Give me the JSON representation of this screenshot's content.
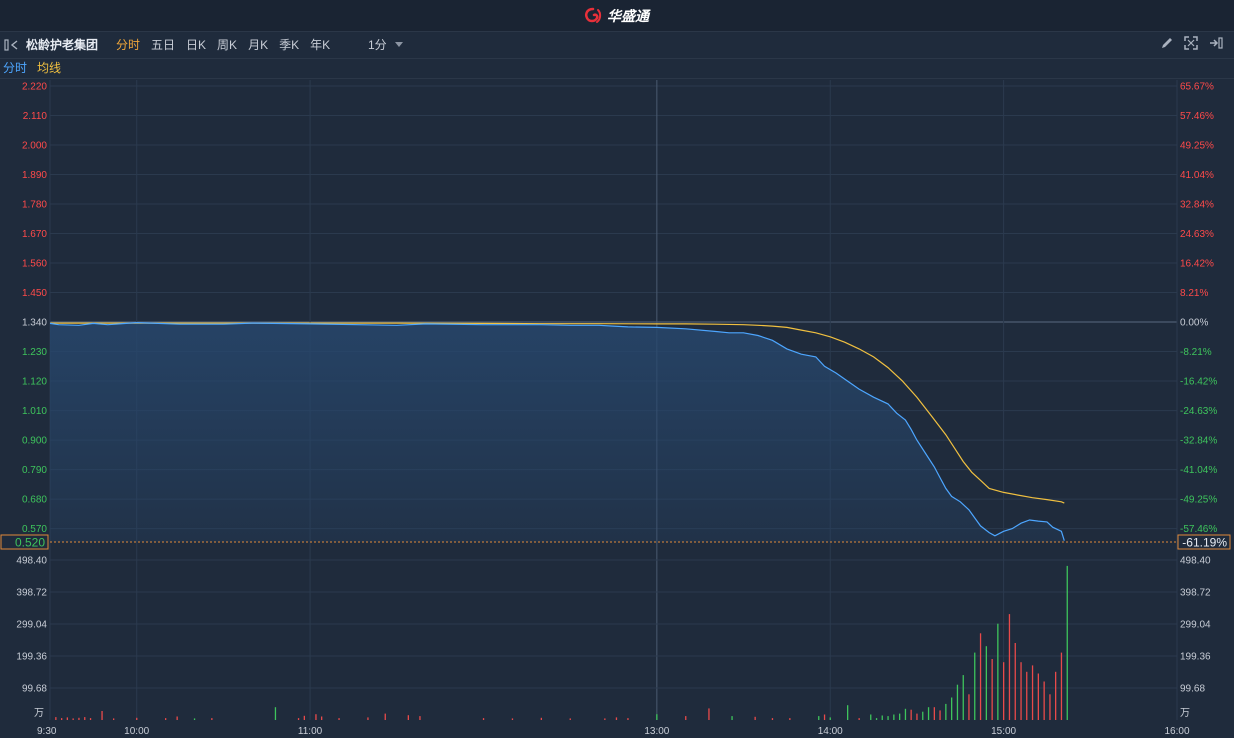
{
  "header": {
    "brand": "华盛通",
    "brand_color": "#e8303a",
    "brand_icon": "swirl-logo-icon"
  },
  "toolbar": {
    "stock_name": "松龄护老集团",
    "tabs": [
      {
        "label": "分时",
        "active": true
      },
      {
        "label": "五日"
      },
      {
        "label": "日K"
      },
      {
        "label": "周K"
      },
      {
        "label": "月K"
      },
      {
        "label": "季K"
      },
      {
        "label": "年K"
      }
    ],
    "interval": "1分",
    "icons": [
      "collapse-panel-icon",
      "draw-pencil-icon",
      "fullscreen-icon",
      "exit-panel-icon"
    ]
  },
  "legend": {
    "intraday_label": "分时",
    "avg_label": "均线",
    "intraday_color": "#4da6ff",
    "avg_color": "#f0c040"
  },
  "chart_data": {
    "type": "line",
    "prev_close": 1.34,
    "current_price_label": "0.520",
    "current_pct_label": "-61.19%",
    "price_axis_left": [
      "2.220",
      "2.110",
      "2.000",
      "1.890",
      "1.780",
      "1.670",
      "1.560",
      "1.450",
      "1.340",
      "1.230",
      "1.120",
      "1.010",
      "0.900",
      "0.790",
      "0.680",
      "0.570"
    ],
    "pct_axis_right": [
      "65.67%",
      "57.46%",
      "49.25%",
      "41.04%",
      "32.84%",
      "24.63%",
      "16.42%",
      "8.21%",
      "0.00%",
      "-8.21%",
      "-16.42%",
      "-24.63%",
      "-32.84%",
      "-41.04%",
      "-49.25%",
      "-57.46%"
    ],
    "ylim": [
      0.52,
      2.22
    ],
    "volume_axis": [
      "498.40",
      "398.72",
      "299.04",
      "199.36",
      "99.68"
    ],
    "volume_unit": "万",
    "time_labels": [
      "9:30",
      "10:00",
      "11:00",
      "13:00",
      "14:00",
      "15:00",
      "16:00"
    ],
    "series": [
      {
        "name": "分时",
        "color": "#4da6ff",
        "points": [
          [
            0,
            1.335
          ],
          [
            3,
            1.33
          ],
          [
            10,
            1.328
          ],
          [
            15,
            1.335
          ],
          [
            20,
            1.33
          ],
          [
            30,
            1.338
          ],
          [
            45,
            1.332
          ],
          [
            60,
            1.332
          ],
          [
            70,
            1.336
          ],
          [
            90,
            1.333
          ],
          [
            120,
            1.328
          ],
          [
            130,
            1.333
          ],
          [
            150,
            1.33
          ],
          [
            170,
            1.33
          ],
          [
            180,
            1.328
          ],
          [
            190,
            1.328
          ],
          [
            195,
            1.325
          ],
          [
            200,
            1.322
          ],
          [
            210,
            1.32
          ],
          [
            220,
            1.315
          ],
          [
            230,
            1.305
          ],
          [
            235,
            1.3
          ],
          [
            240,
            1.3
          ],
          [
            245,
            1.29
          ],
          [
            250,
            1.272
          ],
          [
            255,
            1.24
          ],
          [
            260,
            1.22
          ],
          [
            265,
            1.21
          ],
          [
            268,
            1.175
          ],
          [
            272,
            1.15
          ],
          [
            276,
            1.12
          ],
          [
            280,
            1.09
          ],
          [
            285,
            1.06
          ],
          [
            290,
            1.035
          ],
          [
            293,
            1.0
          ],
          [
            296,
            0.975
          ],
          [
            298,
            0.94
          ],
          [
            300,
            0.9
          ],
          [
            303,
            0.85
          ],
          [
            306,
            0.8
          ],
          [
            308,
            0.76
          ],
          [
            310,
            0.72
          ],
          [
            312,
            0.69
          ],
          [
            315,
            0.67
          ],
          [
            318,
            0.64
          ],
          [
            320,
            0.61
          ],
          [
            322,
            0.58
          ],
          [
            325,
            0.555
          ],
          [
            327,
            0.543
          ],
          [
            330,
            0.56
          ],
          [
            333,
            0.57
          ],
          [
            336,
            0.59
          ],
          [
            339,
            0.602
          ],
          [
            342,
            0.598
          ],
          [
            345,
            0.595
          ],
          [
            347,
            0.575
          ],
          [
            350,
            0.56
          ],
          [
            351,
            0.525
          ]
        ]
      },
      {
        "name": "均线",
        "color": "#f0c040",
        "points": [
          [
            0,
            1.336
          ],
          [
            30,
            1.336
          ],
          [
            60,
            1.336
          ],
          [
            90,
            1.336
          ],
          [
            120,
            1.336
          ],
          [
            150,
            1.335
          ],
          [
            170,
            1.334
          ],
          [
            190,
            1.334
          ],
          [
            210,
            1.333
          ],
          [
            220,
            1.333
          ],
          [
            230,
            1.332
          ],
          [
            240,
            1.33
          ],
          [
            245,
            1.328
          ],
          [
            250,
            1.325
          ],
          [
            255,
            1.32
          ],
          [
            260,
            1.31
          ],
          [
            265,
            1.3
          ],
          [
            270,
            1.285
          ],
          [
            275,
            1.265
          ],
          [
            280,
            1.24
          ],
          [
            285,
            1.21
          ],
          [
            290,
            1.17
          ],
          [
            295,
            1.12
          ],
          [
            300,
            1.06
          ],
          [
            305,
            0.99
          ],
          [
            310,
            0.92
          ],
          [
            313,
            0.87
          ],
          [
            316,
            0.82
          ],
          [
            319,
            0.78
          ],
          [
            322,
            0.75
          ],
          [
            325,
            0.72
          ],
          [
            330,
            0.705
          ],
          [
            335,
            0.695
          ],
          [
            340,
            0.685
          ],
          [
            345,
            0.678
          ],
          [
            350,
            0.67
          ],
          [
            351,
            0.665
          ]
        ]
      }
    ],
    "volume": [
      [
        2,
        9,
        "#e84a4a"
      ],
      [
        4,
        6,
        "#e84a4a"
      ],
      [
        6,
        8,
        "#e84a4a"
      ],
      [
        8,
        5,
        "#e84a4a"
      ],
      [
        10,
        7,
        "#e84a4a"
      ],
      [
        12,
        9,
        "#e84a4a"
      ],
      [
        14,
        6,
        "#e84a4a"
      ],
      [
        18,
        28,
        "#e84a4a"
      ],
      [
        22,
        5,
        "#e84a4a"
      ],
      [
        30,
        7,
        "#e84a4a"
      ],
      [
        40,
        6,
        "#e84a4a"
      ],
      [
        44,
        11,
        "#e84a4a"
      ],
      [
        50,
        5,
        "#3ec45c"
      ],
      [
        56,
        6,
        "#e84a4a"
      ],
      [
        78,
        40,
        "#3ec45c"
      ],
      [
        86,
        6,
        "#e84a4a"
      ],
      [
        88,
        13,
        "#e84a4a"
      ],
      [
        92,
        18,
        "#e84a4a"
      ],
      [
        94,
        11,
        "#e84a4a"
      ],
      [
        100,
        6,
        "#e84a4a"
      ],
      [
        110,
        8,
        "#e84a4a"
      ],
      [
        116,
        20,
        "#e84a4a"
      ],
      [
        124,
        15,
        "#e84a4a"
      ],
      [
        128,
        12,
        "#e84a4a"
      ],
      [
        150,
        6,
        "#e84a4a"
      ],
      [
        160,
        5,
        "#e84a4a"
      ],
      [
        170,
        7,
        "#e84a4a"
      ],
      [
        180,
        5,
        "#e84a4a"
      ],
      [
        192,
        5,
        "#e84a4a"
      ],
      [
        196,
        8,
        "#e84a4a"
      ],
      [
        200,
        6,
        "#e84a4a"
      ],
      [
        210,
        18,
        "#3ec45c"
      ],
      [
        220,
        12,
        "#e84a4a"
      ],
      [
        228,
        36,
        "#e84a4a"
      ],
      [
        236,
        12,
        "#3ec45c"
      ],
      [
        244,
        10,
        "#e84a4a"
      ],
      [
        250,
        6,
        "#e84a4a"
      ],
      [
        256,
        6,
        "#e84a4a"
      ],
      [
        266,
        12,
        "#3ec45c"
      ],
      [
        268,
        17,
        "#e84a4a"
      ],
      [
        270,
        8,
        "#3ec45c"
      ],
      [
        276,
        46,
        "#3ec45c"
      ],
      [
        280,
        6,
        "#e84a4a"
      ],
      [
        284,
        17,
        "#3ec45c"
      ],
      [
        286,
        6,
        "#3ec45c"
      ],
      [
        288,
        14,
        "#3ec45c"
      ],
      [
        290,
        12,
        "#3ec45c"
      ],
      [
        292,
        17,
        "#3ec45c"
      ],
      [
        294,
        20,
        "#3ec45c"
      ],
      [
        296,
        35,
        "#3ec45c"
      ],
      [
        298,
        32,
        "#e84a4a"
      ],
      [
        300,
        20,
        "#e84a4a"
      ],
      [
        302,
        26,
        "#3ec45c"
      ],
      [
        304,
        40,
        "#3ec45c"
      ],
      [
        306,
        40,
        "#e84a4a"
      ],
      [
        308,
        30,
        "#e84a4a"
      ],
      [
        310,
        50,
        "#3ec45c"
      ],
      [
        312,
        70,
        "#3ec45c"
      ],
      [
        314,
        110,
        "#3ec45c"
      ],
      [
        316,
        140,
        "#3ec45c"
      ],
      [
        318,
        80,
        "#e84a4a"
      ],
      [
        320,
        210,
        "#3ec45c"
      ],
      [
        322,
        270,
        "#e84a4a"
      ],
      [
        324,
        230,
        "#3ec45c"
      ],
      [
        326,
        190,
        "#e84a4a"
      ],
      [
        328,
        300,
        "#3ec45c"
      ],
      [
        330,
        180,
        "#e84a4a"
      ],
      [
        332,
        330,
        "#e84a4a"
      ],
      [
        334,
        240,
        "#e84a4a"
      ],
      [
        336,
        180,
        "#e84a4a"
      ],
      [
        338,
        150,
        "#e84a4a"
      ],
      [
        340,
        170,
        "#e84a4a"
      ],
      [
        342,
        145,
        "#e84a4a"
      ],
      [
        344,
        120,
        "#e84a4a"
      ],
      [
        346,
        80,
        "#e84a4a"
      ],
      [
        348,
        150,
        "#e84a4a"
      ],
      [
        350,
        210,
        "#e84a4a"
      ],
      [
        352,
        480,
        "#3ec45c"
      ]
    ]
  }
}
